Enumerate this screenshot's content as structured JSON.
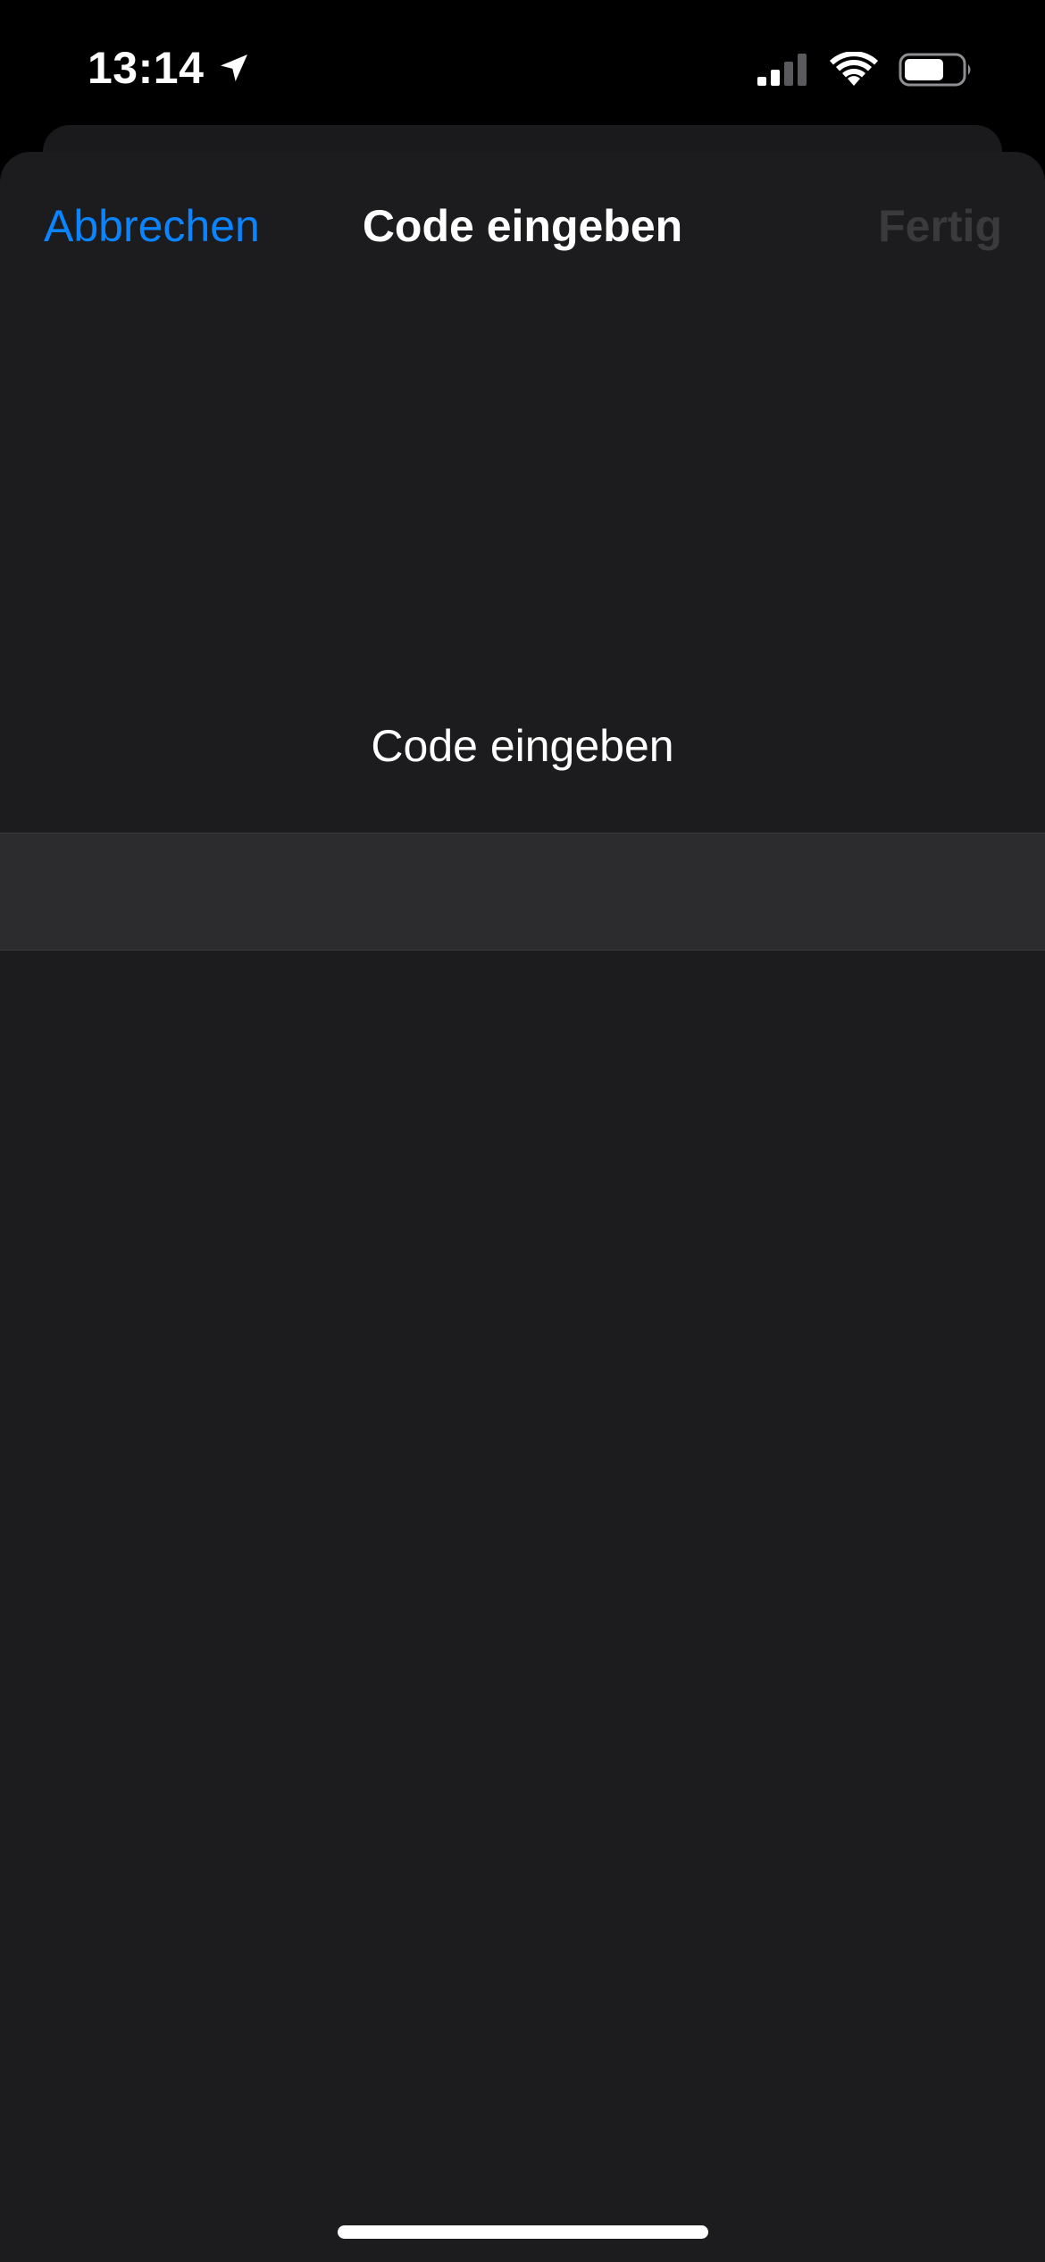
{
  "status_bar": {
    "time": "13:14",
    "location_icon": "location-arrow-icon",
    "signal_icon": "cellular-signal-icon",
    "signal_bars_active": 2,
    "signal_bars_total": 4,
    "wifi_icon": "wifi-icon",
    "battery_icon": "battery-icon",
    "battery_level": 0.7
  },
  "nav": {
    "cancel_label": "Abbrechen",
    "title": "Code eingeben",
    "done_label": "Fertig"
  },
  "content": {
    "prompt": "Code eingeben",
    "code_value": "",
    "code_placeholder": ""
  },
  "colors": {
    "accent": "#0a84ff",
    "disabled": "#3a3a3c",
    "sheet_background": "#1c1c1e",
    "field_background": "#2c2c2e"
  }
}
